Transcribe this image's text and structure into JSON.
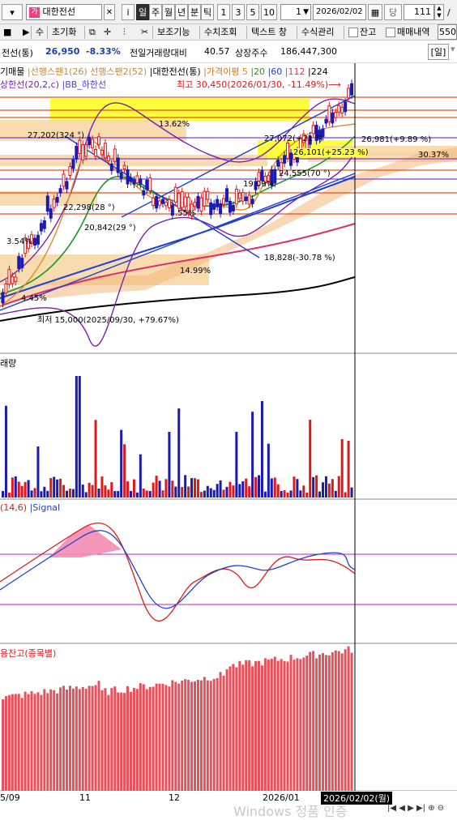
{
  "toolbar": {
    "stock_name": "대한전선",
    "periods": [
      "i",
      "일",
      "주",
      "월",
      "년",
      "분",
      "틱",
      "1",
      "3",
      "5",
      "10"
    ],
    "selected_period": "일",
    "interval_value": "1",
    "date": "2026/02/02",
    "day_label": "당",
    "count_value": "111",
    "slash": "/",
    "buttons": [
      "수",
      "초기화",
      "보조기능",
      "수치조회",
      "텍스트 창",
      "수식관리"
    ],
    "check_labels": [
      "잔고",
      "매매내역"
    ],
    "right_field": "550"
  },
  "info": {
    "name": "전선(통)",
    "price": "26,950",
    "change": "-8.33%",
    "volume_label": "전일거래량대비",
    "volume_value": "40.57",
    "shares_label": "상장주수",
    "shares_value": "186,447,300",
    "period_tag": "[일]"
  },
  "legend": {
    "row1": [
      "기매물",
      "선행스팬1(26)",
      "선행스팬2(52)",
      "대한전선(통)",
      "가격이평",
      "5",
      "20",
      "60",
      "112",
      "224"
    ],
    "row2": [
      "상한선(20,2,c)",
      "BB_하한선"
    ],
    "high_note": "최고 30,450(2026/01/30, -11.49%)"
  },
  "annotations": {
    "a1": "13.62%",
    "a2": "27,202(324 °)",
    "a3": "27,072(+21 °)",
    "a4": "26,981(+9.89 %)",
    "a5": "26,101(+25.23 %)",
    "a6": "30.37%",
    "a7": "24,555(70 °)",
    "a8": "19.09%",
    "a9": "22,298(28 °)",
    "a10": "20,842(29 °)",
    "a11": "3.54%",
    "a12": "4.45%",
    "a13": "14.99%",
    "a14": "18,828(-30.78 %)",
    "a15": "최저 15,000(2025/09/30, +79.67%)",
    "a16": ".55%"
  },
  "panes": {
    "volume": "래량",
    "stoch": "(14,6)",
    "signal": "Signal",
    "credit": "용잔고(종목별)"
  },
  "xaxis": {
    "labels": [
      "5/09",
      "11",
      "12",
      "2026/01"
    ],
    "cursor_date": "2026/02/02(월)"
  },
  "watermark": "Windows 정품 인증",
  "colors": {
    "up": "#e01818",
    "down": "#1a1ab4",
    "ma5": "#e08a2a",
    "ma20": "#1e9a1e",
    "ma60": "#2040d0",
    "ma112": "#e0306a",
    "ma224": "#000000",
    "bollinger": "#7a1fb0",
    "band": "#f6d39c",
    "highlight": "#ffff3a"
  }
}
